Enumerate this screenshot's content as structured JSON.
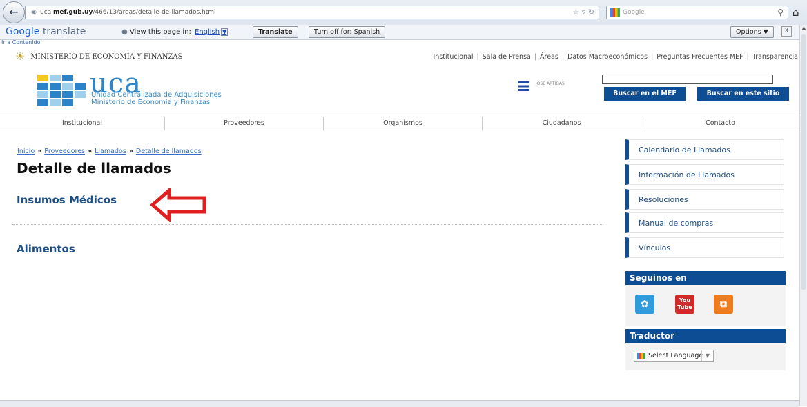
{
  "browser": {
    "url_prefix": "uca.",
    "url_domain": "mef.gub.uy",
    "url_path": "/466/13/areas/detalle-de-llamados.html",
    "search_placeholder": "Google"
  },
  "translate_bar": {
    "logo_google": "Google",
    "logo_translate": "translate",
    "view_text": "View this page in:",
    "language": "English",
    "translate_button": "Translate",
    "turnoff_button": "Turn off for: Spanish",
    "options_button": "Options ▼",
    "close": "X"
  },
  "site": {
    "skip_link": "Ir a Contenido",
    "ministry": "MINISTERIO DE ECONOMÍA Y FINANZAS",
    "top_nav": [
      "Institucional",
      "Sala de Prensa",
      "Áreas",
      "Datos Macroeconómicos",
      "Preguntas Frecuentes MEF",
      "Transparencia"
    ],
    "logo_word": "uca",
    "logo_sub1": "Unidad Centralizada de Adquisiciones",
    "logo_sub2": "Ministerio de Economía y Finanzas",
    "artigas_text": "JOSÉ ARTIGAS",
    "btn_mef": "Buscar en el MEF",
    "btn_sitio": "Buscar en este sitio",
    "main_nav": [
      "Institucional",
      "Proveedores",
      "Organismos",
      "Ciudadanos",
      "Contacto"
    ]
  },
  "content": {
    "breadcrumb": [
      "Inicio",
      "Proveedores",
      "Llamados",
      "Detalle de llamados"
    ],
    "breadcrumb_sep": "»",
    "title": "Detalle de llamados",
    "sections": [
      "Insumos Médicos",
      "Alimentos"
    ]
  },
  "sidebar": {
    "links": [
      "Calendario de Llamados",
      "Información de Llamados",
      "Resoluciones",
      "Manual de compras",
      "Vínculos"
    ],
    "social_heading": "Seguinos en",
    "youtube_label": "You Tube",
    "translator_heading": "Traductor",
    "select_language": "Select Language"
  },
  "colors": {
    "brand_blue": "#0d4d94",
    "link_blue": "#1e4f86",
    "arrow_red": "#e02020"
  }
}
